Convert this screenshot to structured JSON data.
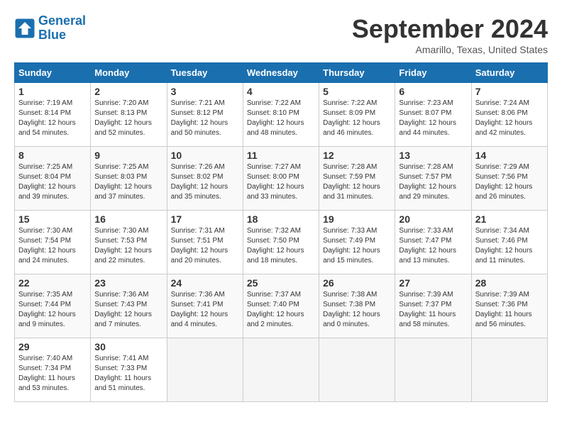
{
  "logo": {
    "line1": "General",
    "line2": "Blue"
  },
  "title": "September 2024",
  "location": "Amarillo, Texas, United States",
  "weekdays": [
    "Sunday",
    "Monday",
    "Tuesday",
    "Wednesday",
    "Thursday",
    "Friday",
    "Saturday"
  ],
  "weeks": [
    [
      {
        "day": "1",
        "sunrise": "7:19 AM",
        "sunset": "8:14 PM",
        "daylight": "12 hours and 54 minutes."
      },
      {
        "day": "2",
        "sunrise": "7:20 AM",
        "sunset": "8:13 PM",
        "daylight": "12 hours and 52 minutes."
      },
      {
        "day": "3",
        "sunrise": "7:21 AM",
        "sunset": "8:12 PM",
        "daylight": "12 hours and 50 minutes."
      },
      {
        "day": "4",
        "sunrise": "7:22 AM",
        "sunset": "8:10 PM",
        "daylight": "12 hours and 48 minutes."
      },
      {
        "day": "5",
        "sunrise": "7:22 AM",
        "sunset": "8:09 PM",
        "daylight": "12 hours and 46 minutes."
      },
      {
        "day": "6",
        "sunrise": "7:23 AM",
        "sunset": "8:07 PM",
        "daylight": "12 hours and 44 minutes."
      },
      {
        "day": "7",
        "sunrise": "7:24 AM",
        "sunset": "8:06 PM",
        "daylight": "12 hours and 42 minutes."
      }
    ],
    [
      {
        "day": "8",
        "sunrise": "7:25 AM",
        "sunset": "8:04 PM",
        "daylight": "12 hours and 39 minutes."
      },
      {
        "day": "9",
        "sunrise": "7:25 AM",
        "sunset": "8:03 PM",
        "daylight": "12 hours and 37 minutes."
      },
      {
        "day": "10",
        "sunrise": "7:26 AM",
        "sunset": "8:02 PM",
        "daylight": "12 hours and 35 minutes."
      },
      {
        "day": "11",
        "sunrise": "7:27 AM",
        "sunset": "8:00 PM",
        "daylight": "12 hours and 33 minutes."
      },
      {
        "day": "12",
        "sunrise": "7:28 AM",
        "sunset": "7:59 PM",
        "daylight": "12 hours and 31 minutes."
      },
      {
        "day": "13",
        "sunrise": "7:28 AM",
        "sunset": "7:57 PM",
        "daylight": "12 hours and 29 minutes."
      },
      {
        "day": "14",
        "sunrise": "7:29 AM",
        "sunset": "7:56 PM",
        "daylight": "12 hours and 26 minutes."
      }
    ],
    [
      {
        "day": "15",
        "sunrise": "7:30 AM",
        "sunset": "7:54 PM",
        "daylight": "12 hours and 24 minutes."
      },
      {
        "day": "16",
        "sunrise": "7:30 AM",
        "sunset": "7:53 PM",
        "daylight": "12 hours and 22 minutes."
      },
      {
        "day": "17",
        "sunrise": "7:31 AM",
        "sunset": "7:51 PM",
        "daylight": "12 hours and 20 minutes."
      },
      {
        "day": "18",
        "sunrise": "7:32 AM",
        "sunset": "7:50 PM",
        "daylight": "12 hours and 18 minutes."
      },
      {
        "day": "19",
        "sunrise": "7:33 AM",
        "sunset": "7:49 PM",
        "daylight": "12 hours and 15 minutes."
      },
      {
        "day": "20",
        "sunrise": "7:33 AM",
        "sunset": "7:47 PM",
        "daylight": "12 hours and 13 minutes."
      },
      {
        "day": "21",
        "sunrise": "7:34 AM",
        "sunset": "7:46 PM",
        "daylight": "12 hours and 11 minutes."
      }
    ],
    [
      {
        "day": "22",
        "sunrise": "7:35 AM",
        "sunset": "7:44 PM",
        "daylight": "12 hours and 9 minutes."
      },
      {
        "day": "23",
        "sunrise": "7:36 AM",
        "sunset": "7:43 PM",
        "daylight": "12 hours and 7 minutes."
      },
      {
        "day": "24",
        "sunrise": "7:36 AM",
        "sunset": "7:41 PM",
        "daylight": "12 hours and 4 minutes."
      },
      {
        "day": "25",
        "sunrise": "7:37 AM",
        "sunset": "7:40 PM",
        "daylight": "12 hours and 2 minutes."
      },
      {
        "day": "26",
        "sunrise": "7:38 AM",
        "sunset": "7:38 PM",
        "daylight": "12 hours and 0 minutes."
      },
      {
        "day": "27",
        "sunrise": "7:39 AM",
        "sunset": "7:37 PM",
        "daylight": "11 hours and 58 minutes."
      },
      {
        "day": "28",
        "sunrise": "7:39 AM",
        "sunset": "7:36 PM",
        "daylight": "11 hours and 56 minutes."
      }
    ],
    [
      {
        "day": "29",
        "sunrise": "7:40 AM",
        "sunset": "7:34 PM",
        "daylight": "11 hours and 53 minutes."
      },
      {
        "day": "30",
        "sunrise": "7:41 AM",
        "sunset": "7:33 PM",
        "daylight": "11 hours and 51 minutes."
      },
      null,
      null,
      null,
      null,
      null
    ]
  ]
}
